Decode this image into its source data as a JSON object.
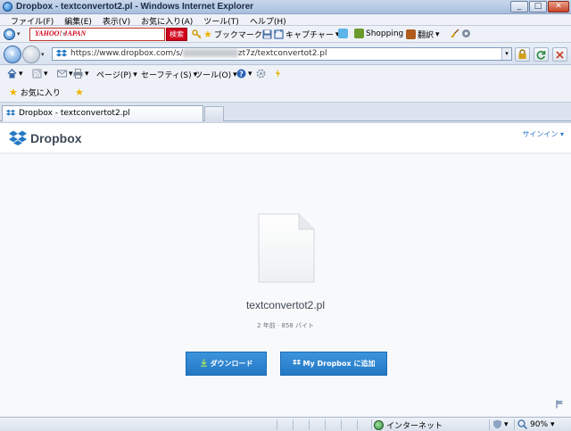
{
  "window": {
    "title": "Dropbox - textconvertot2.pl - Windows Internet Explorer",
    "controls": [
      "minimize",
      "maximize",
      "close"
    ]
  },
  "menu": {
    "items": [
      "ファイル(F)",
      "編集(E)",
      "表示(V)",
      "お気に入り(A)",
      "ツール(T)",
      "ヘルプ(H)"
    ]
  },
  "yahoo_toolbar": {
    "logo": "YAHOO! JAPAN",
    "search_placeholder": "",
    "search_button": "検索",
    "bookmark": "ブックマーク",
    "capture": "キャプチャー",
    "shopping": "Shopping",
    "translate": "翻訳"
  },
  "address_bar": {
    "url_prefix": "https://www.dropbox.com/s/",
    "url_suffix": "zt7z/textconvertot2.pl"
  },
  "command_bar": {
    "page": "ページ(P)",
    "safety": "セーフティ(S)",
    "tools": "ツール(O)"
  },
  "favorites_bar": {
    "favorites": "お気に入り"
  },
  "tabs": [
    {
      "label": "Dropbox - textconvertot2.pl"
    }
  ],
  "page": {
    "brand": "Dropbox",
    "signin": "サインイン ▾",
    "file_name": "textconvertot2.pl",
    "file_meta": "2 年前 · 858 バイト",
    "download_button": "ダウンロード",
    "add_button": "My Dropbox に追加"
  },
  "status_bar": {
    "zone": "インターネット",
    "zoom": "90%"
  },
  "colors": {
    "dropbox_blue": "#2478c4",
    "link_blue": "#2a75c9",
    "yahoo_red": "#d0021b"
  }
}
